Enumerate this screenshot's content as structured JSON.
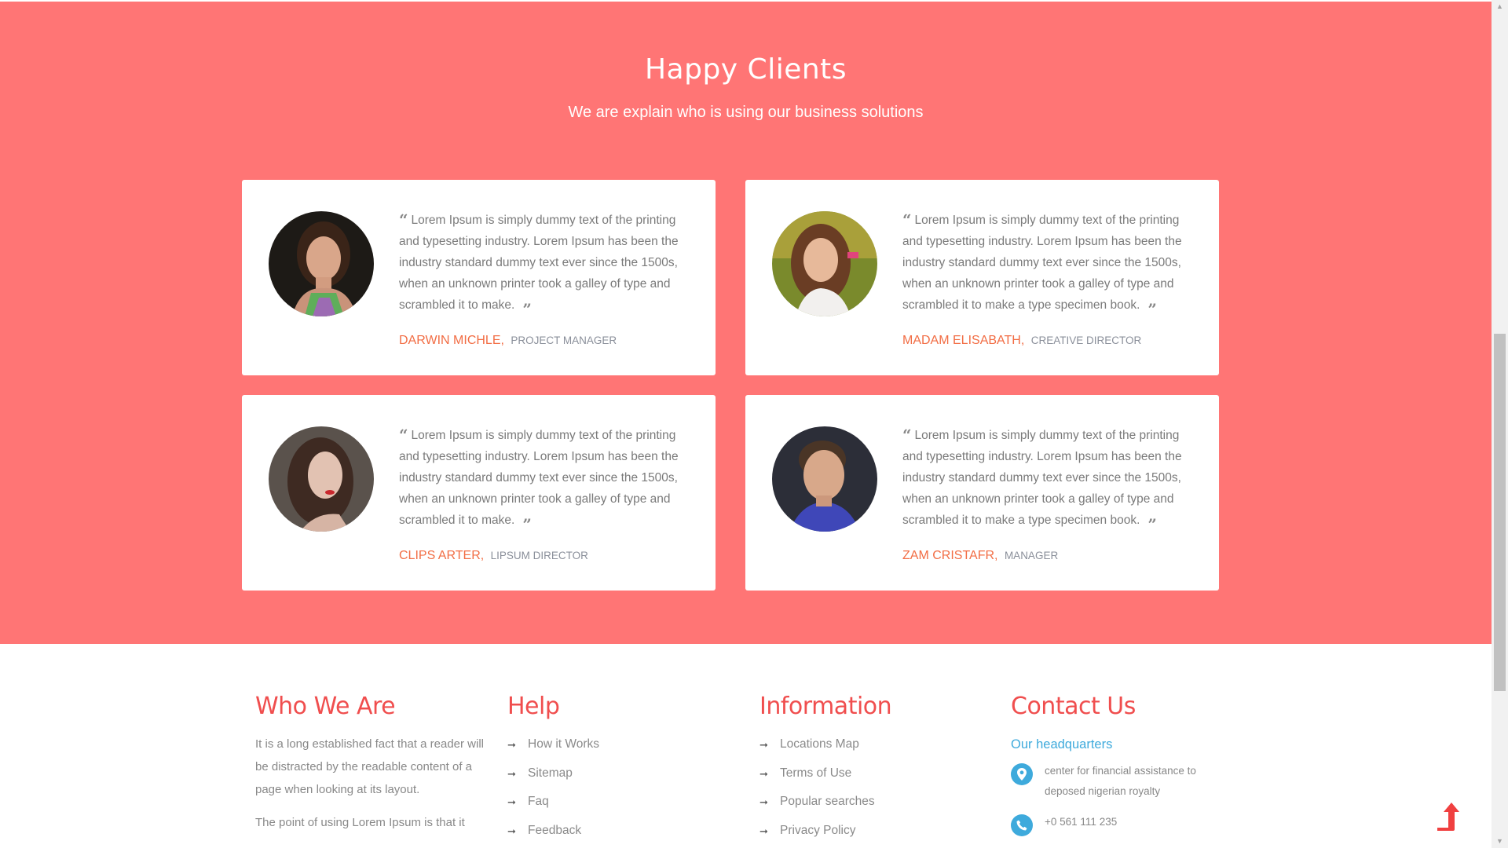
{
  "clients": {
    "title": "Happy Clients",
    "subtitle": "We are explain who is using our business solutions",
    "testimonials": [
      {
        "text": "Lorem Ipsum is simply dummy text of the printing and typesetting industry. Lorem Ipsum has been the industry standard dummy text ever since the 1500s, when an unknown printer took a galley of type and scrambled it to make.",
        "name": "DARWIN MICHLE",
        "role": "PROJECT MANAGER"
      },
      {
        "text": "Lorem Ipsum is simply dummy text of the printing and typesetting industry. Lorem Ipsum has been the industry standard dummy text ever since the 1500s, when an unknown printer took a galley of type and scrambled it to make a type specimen book.",
        "name": "MADAM ELISABATH",
        "role": "CREATIVE DIRECTOR"
      },
      {
        "text": "Lorem Ipsum is simply dummy text of the printing and typesetting industry. Lorem Ipsum has been the industry standard dummy text ever since the 1500s, when an unknown printer took a galley of type and scrambled it to make.",
        "name": "CLIPS ARTER",
        "role": "LIPSUM DIRECTOR"
      },
      {
        "text": "Lorem Ipsum is simply dummy text of the printing and typesetting industry. Lorem Ipsum has been the industry standard dummy text ever since the 1500s, when an unknown printer took a galley of type and scrambled it to make a type specimen book.",
        "name": "ZAM CRISTAFR",
        "role": "MANAGER"
      }
    ]
  },
  "footer": {
    "who": {
      "title": "Who We Are",
      "p1": "It is a long established fact that a reader will be distracted by the readable content of a page when looking at its layout.",
      "p2": "The point of using Lorem Ipsum is that it"
    },
    "help": {
      "title": "Help",
      "links": [
        "How it Works",
        "Sitemap",
        "Faq",
        "Feedback"
      ]
    },
    "information": {
      "title": "Information",
      "links": [
        "Locations Map",
        "Terms of Use",
        "Popular searches",
        "Privacy Policy"
      ]
    },
    "contact": {
      "title": "Contact Us",
      "hq_label": "Our headquarters",
      "address": "center for financial assistance to deposed nigerian royalty",
      "phone": "+0 561 111 235"
    }
  },
  "colors": {
    "section_bg": "#ff7575",
    "accent_orange": "#f26d44",
    "footer_heading": "#f04e4e",
    "contact_blue": "#3eaadc"
  },
  "icons": {
    "quote_open": "quote-open-icon",
    "quote_close": "quote-close-icon",
    "list_arrow": "arrow-right-icon",
    "location": "map-pin-icon",
    "phone": "phone-icon",
    "scroll_top": "scroll-to-top-icon"
  }
}
